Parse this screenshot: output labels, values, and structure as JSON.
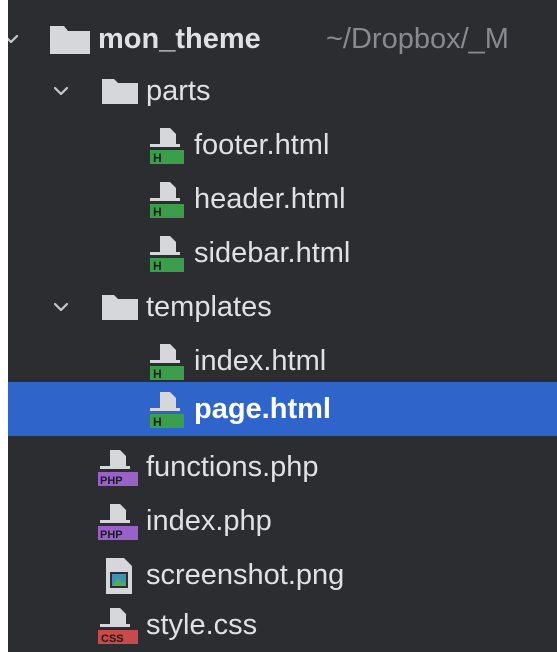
{
  "tree": {
    "root": {
      "label": "mon_theme",
      "path": "~/Dropbox/_M"
    },
    "folders": [
      {
        "label": "parts",
        "files": [
          {
            "label": "footer.html",
            "type": "html"
          },
          {
            "label": "header.html",
            "type": "html"
          },
          {
            "label": "sidebar.html",
            "type": "html"
          }
        ]
      },
      {
        "label": "templates",
        "files": [
          {
            "label": "index.html",
            "type": "html"
          },
          {
            "label": "page.html",
            "type": "html",
            "selected": true
          }
        ]
      }
    ],
    "files": [
      {
        "label": "functions.php",
        "type": "php"
      },
      {
        "label": "index.php",
        "type": "php"
      },
      {
        "label": "screenshot.png",
        "type": "image"
      },
      {
        "label": "style.css",
        "type": "css"
      }
    ]
  },
  "badges": {
    "html": "H",
    "php": "PHP",
    "css": "CSS"
  },
  "colors": {
    "background": "#2b2d30",
    "selection": "#2f65ca",
    "text": "#dfe1e5",
    "path": "#868a91",
    "html_badge": "#3a9e4a",
    "php_badge": "#9a62c9",
    "css_badge": "#c94a4a"
  }
}
